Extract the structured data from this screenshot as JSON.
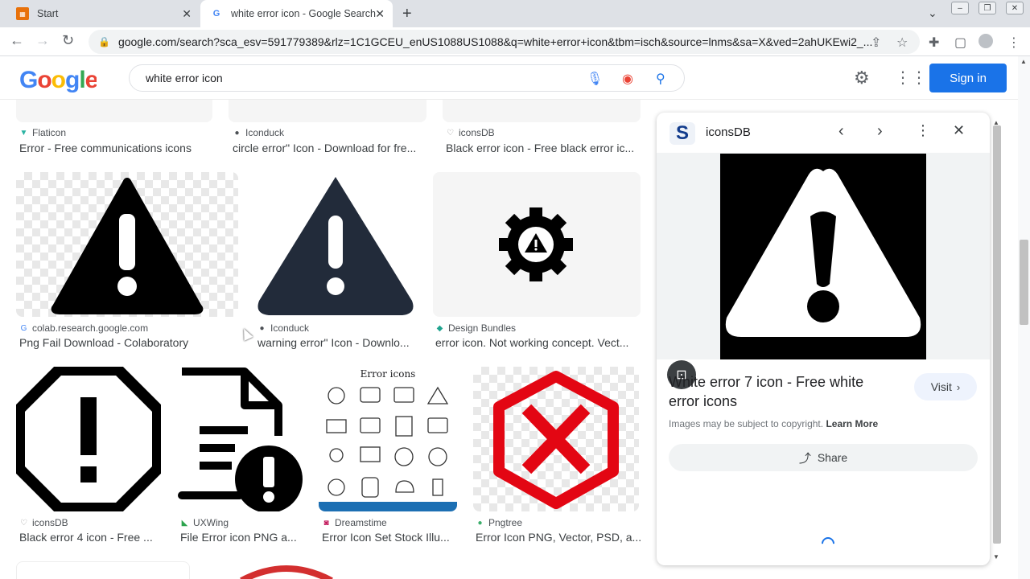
{
  "browser": {
    "tabs": [
      {
        "title": "Start",
        "icon": "start-page-icon"
      },
      {
        "title": "white error icon - Google Search",
        "icon": "google-g-icon"
      }
    ],
    "url": "google.com/search?sca_esv=591779389&rlz=1C1GCEU_enUS1088US1088&q=white+error+icon&tbm=isch&source=lnms&sa=X&ved=2ahUKEwi2_..."
  },
  "google": {
    "logo": "Google",
    "query": "white error icon",
    "signin_label": "Sign in"
  },
  "results": {
    "row1": [
      {
        "source": "Flaticon",
        "title": "Error - Free communications icons"
      },
      {
        "source": "Iconduck",
        "title": "circle error\" Icon - Download for fre..."
      },
      {
        "source": "iconsDB",
        "title": "Black error icon - Free black error ic..."
      }
    ],
    "row2": [
      {
        "source": "colab.research.google.com",
        "title": "Png Fail Download - Colaboratory"
      },
      {
        "source": "Iconduck",
        "title": "warning error\" Icon - Downlo..."
      },
      {
        "source": "Design Bundles",
        "title": "error icon. Not working concept. Vect..."
      }
    ],
    "row3": [
      {
        "source": "iconsDB",
        "title": "Black error 4 icon - Free ..."
      },
      {
        "source": "UXWing",
        "title": "File Error icon PNG a..."
      },
      {
        "source": "Dreamstime",
        "title": "Error Icon Set Stock Illu..."
      },
      {
        "source": "Pngtree",
        "title": "Error Icon PNG, Vector, PSD, a..."
      }
    ],
    "error_icons_heading": "Error icons"
  },
  "panel": {
    "site": "iconsDB",
    "site_logo": "S",
    "title": "White error 7 icon - Free white error icons",
    "visit_label": "Visit",
    "copyright": "Images may be subject to copyright.",
    "learn_more": "Learn More",
    "share_label": "Share"
  }
}
